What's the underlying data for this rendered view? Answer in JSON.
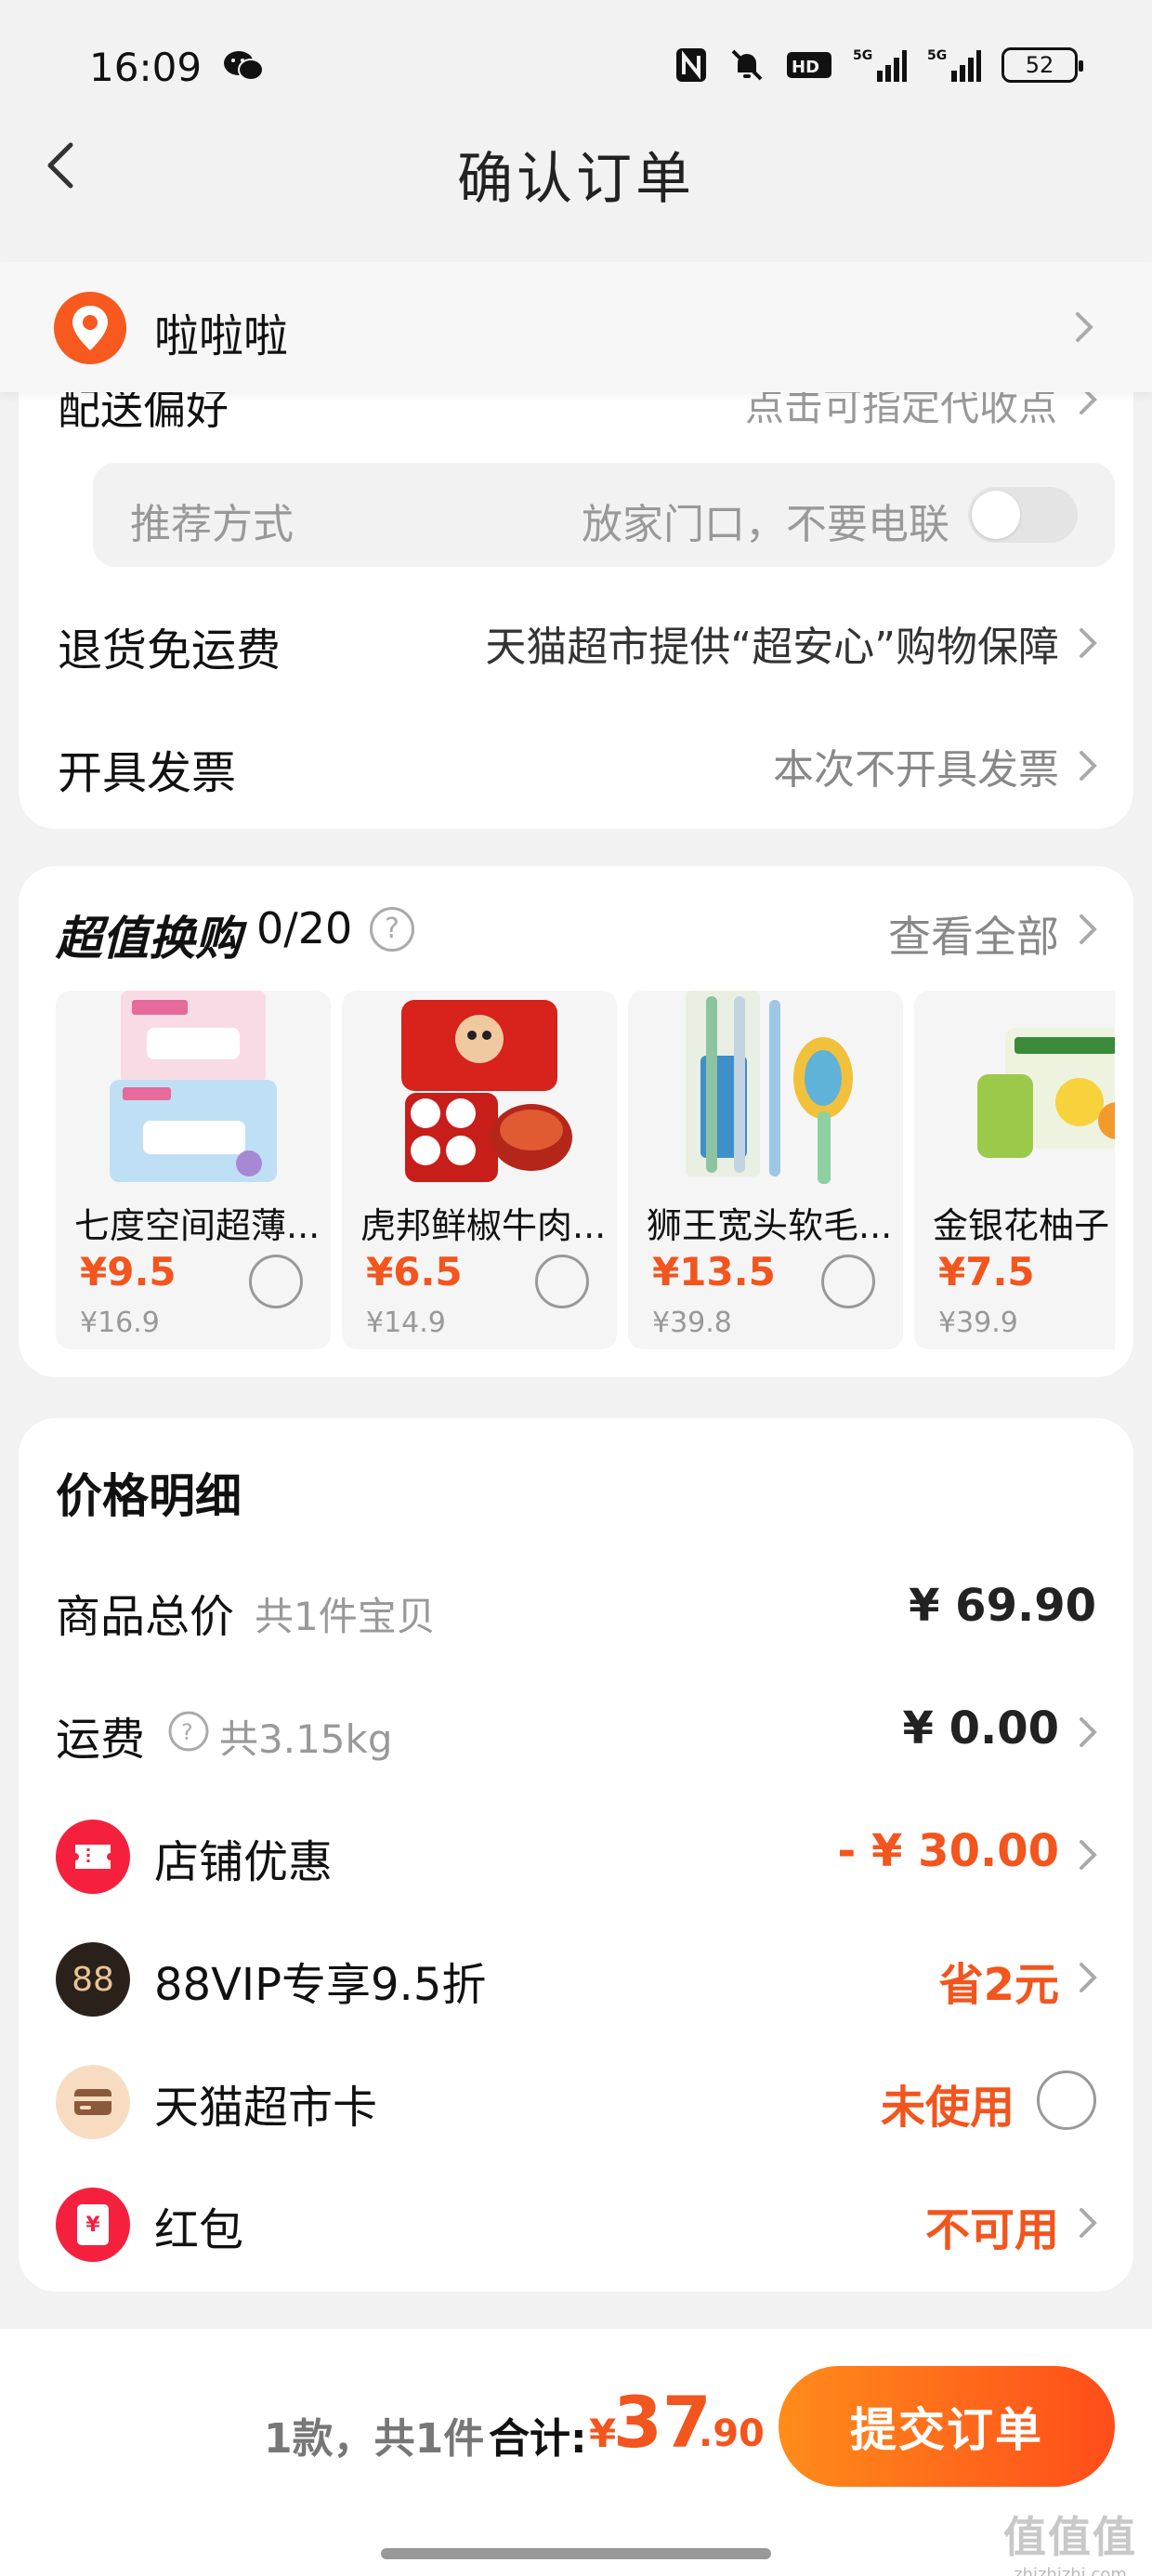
{
  "status_bar": {
    "time": "16:09",
    "battery": "52",
    "network1": "5G",
    "network2": "5G"
  },
  "header": {
    "title": "确认订单"
  },
  "address": {
    "name": "啦啦啦"
  },
  "delivery": {
    "partial_label": "配送偏好",
    "partial_value": "点击可指定代收点",
    "recommend_label": "推荐方式",
    "recommend_value": "放家门口，不要电联",
    "return_label": "退货免运费",
    "return_value": "天猫超市提供“超安心”购物保障",
    "invoice_label": "开具发票",
    "invoice_value": "本次不开具发票"
  },
  "swap": {
    "title": "超值换购",
    "count": "0/20",
    "help": "?",
    "see_all": "查看全部",
    "products": [
      {
        "name": "七度空间超薄...",
        "price": "¥9.5",
        "original": "¥16.9",
        "image": "pad-package"
      },
      {
        "name": "虎邦鲜椒牛肉...",
        "price": "¥6.5",
        "original": "¥14.9",
        "image": "sauce-pack"
      },
      {
        "name": "狮王宽头软毛...",
        "price": "¥13.5",
        "original": "¥39.8",
        "image": "toothbrush"
      },
      {
        "name": "金银花柚子",
        "price": "¥7.5",
        "original": "¥39.9",
        "image": "tea-box"
      }
    ]
  },
  "price_detail": {
    "title": "价格明细",
    "goods_label": "商品总价",
    "goods_note": "共1件宝贝",
    "goods_value": "¥ 69.90",
    "shipping_label": "运费",
    "shipping_note": "共3.15kg",
    "shipping_value": "¥ 0.00",
    "shop_discount_label": "店铺优惠",
    "shop_discount_value": "- ¥ 30.00",
    "vip_label": "88VIP专享9.5折",
    "vip_badge": "88",
    "vip_value": "省2元",
    "card_label": "天猫超市卡",
    "card_value": "未使用",
    "redpacket_label": "红包",
    "redpacket_badge": "¥",
    "redpacket_value": "不可用"
  },
  "bottom": {
    "summary": "1款，共1件",
    "total_label": "合计:",
    "currency": "¥",
    "total_int": "37",
    "total_dec": ".90",
    "submit": "提交订单",
    "watermark_logo": "值值值",
    "watermark_url": "zhizhizhi.com"
  },
  "colors": {
    "accent": "#f2551d",
    "button_start": "#ff8c1a",
    "button_end": "#ff4d1a"
  }
}
